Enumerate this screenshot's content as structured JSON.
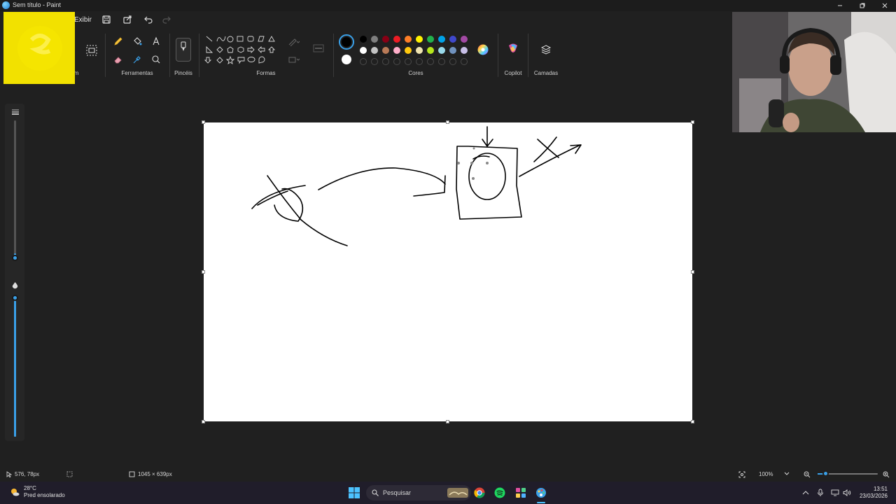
{
  "window": {
    "title": "Sem título - Paint"
  },
  "menu": {
    "exibir": "Exibir"
  },
  "ribbon": {
    "groups": {
      "imagem_fragment": "m",
      "ferramentas": "Ferramentas",
      "pinceis": "Pincéis",
      "formas": "Formas",
      "cores": "Cores",
      "copilot": "Copilot",
      "camadas": "Camadas"
    },
    "colors": {
      "primary": "#000000",
      "secondary": "#ffffff",
      "palette_row1": [
        "#000000",
        "#7f7f7f",
        "#880015",
        "#ed1c24",
        "#ff7f27",
        "#fff200",
        "#22b14c",
        "#00a2e8",
        "#3f48cc",
        "#a349a4"
      ],
      "palette_row2": [
        "#ffffff",
        "#c3c3c3",
        "#b97a57",
        "#ffaec9",
        "#ffc90e",
        "#efe4b0",
        "#b5e61d",
        "#99d9ea",
        "#7092be",
        "#c8bfe7"
      ]
    }
  },
  "status": {
    "cursor_position": "576, 78px",
    "canvas_size": "1045 × 639px",
    "zoom": "100%",
    "zoom_fraction": 0.1
  },
  "taskbar": {
    "weather_temp": "28°C",
    "weather_desc": "Pred ensolarado",
    "search_placeholder": "Pesquisar",
    "time": "13:51",
    "date": "23/03/2026"
  },
  "icons": {
    "app": "paint-icon",
    "save": "save-icon",
    "share": "share-icon",
    "undo": "undo-icon",
    "redo": "redo-icon"
  }
}
